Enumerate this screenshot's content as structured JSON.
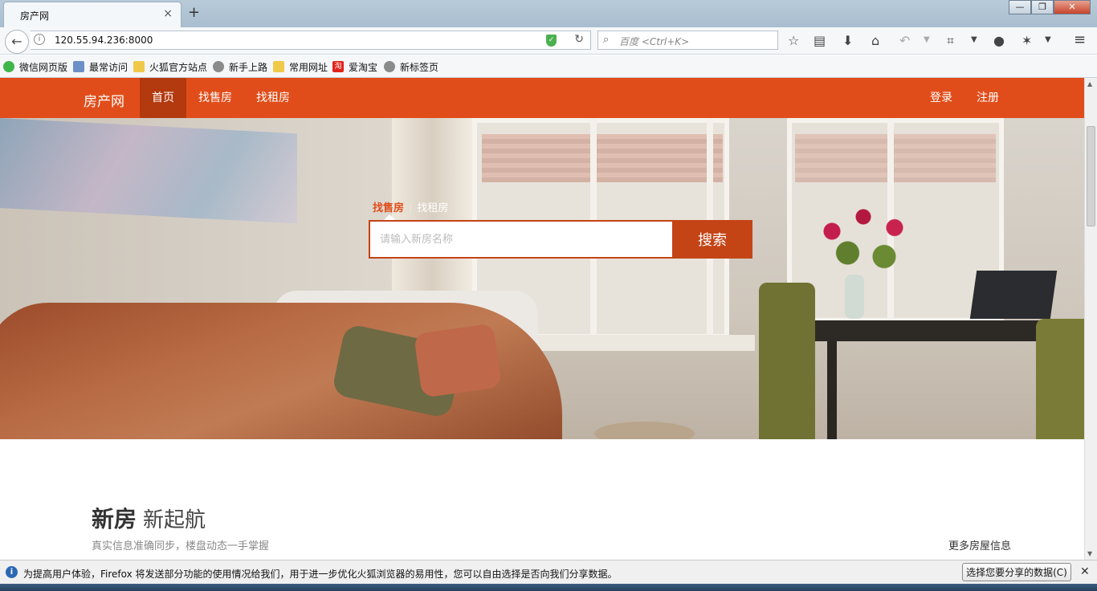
{
  "browser": {
    "tab_title": "房产网",
    "tab_close": "×",
    "new_tab": "+",
    "window_buttons": {
      "minimize": "—",
      "maximize": "❐",
      "close": "✕"
    },
    "url": "120.55.94.236:8000",
    "search_placeholder": "百度 <Ctrl+K>",
    "bookmarks": [
      {
        "label": "微信网页版",
        "icon": "wechat-icon"
      },
      {
        "label": "最常访问",
        "icon": "most-visited-icon"
      },
      {
        "label": "火狐官方站点",
        "icon": "folder-icon"
      },
      {
        "label": "新手上路",
        "icon": "globe-icon"
      },
      {
        "label": "常用网址",
        "icon": "folder-icon"
      },
      {
        "label": "爱淘宝",
        "icon": "taobao-icon",
        "glyph": "淘"
      },
      {
        "label": "新标签页",
        "icon": "globe-icon"
      }
    ]
  },
  "site": {
    "logo": "房产网",
    "nav": [
      {
        "label": "首页",
        "active": true
      },
      {
        "label": "找售房",
        "active": false
      },
      {
        "label": "找租房",
        "active": false
      }
    ],
    "login": "登录",
    "register": "注册"
  },
  "hero": {
    "tabs": [
      "找售房",
      "找租房"
    ],
    "tab_separator": "|",
    "search_placeholder": "请输入新房名称",
    "search_button": "搜索"
  },
  "section": {
    "title_strong": "新房",
    "title_light": "新起航",
    "subtitle": "真实信息准确同步，楼盘动态一手掌握",
    "more": "更多房屋信息"
  },
  "notification": {
    "icon": "i",
    "text": "为提高用户体验，Firefox 将发送部分功能的使用情况给我们，用于进一步优化火狐浏览器的易用性，您可以自由选择是否向我们分享数据。",
    "button": "选择您要分享的数据(C)",
    "close": "✕"
  },
  "colors": {
    "brand": "#e14d1a",
    "brand_dark": "#c44416",
    "nav_active": "#b3390f"
  }
}
